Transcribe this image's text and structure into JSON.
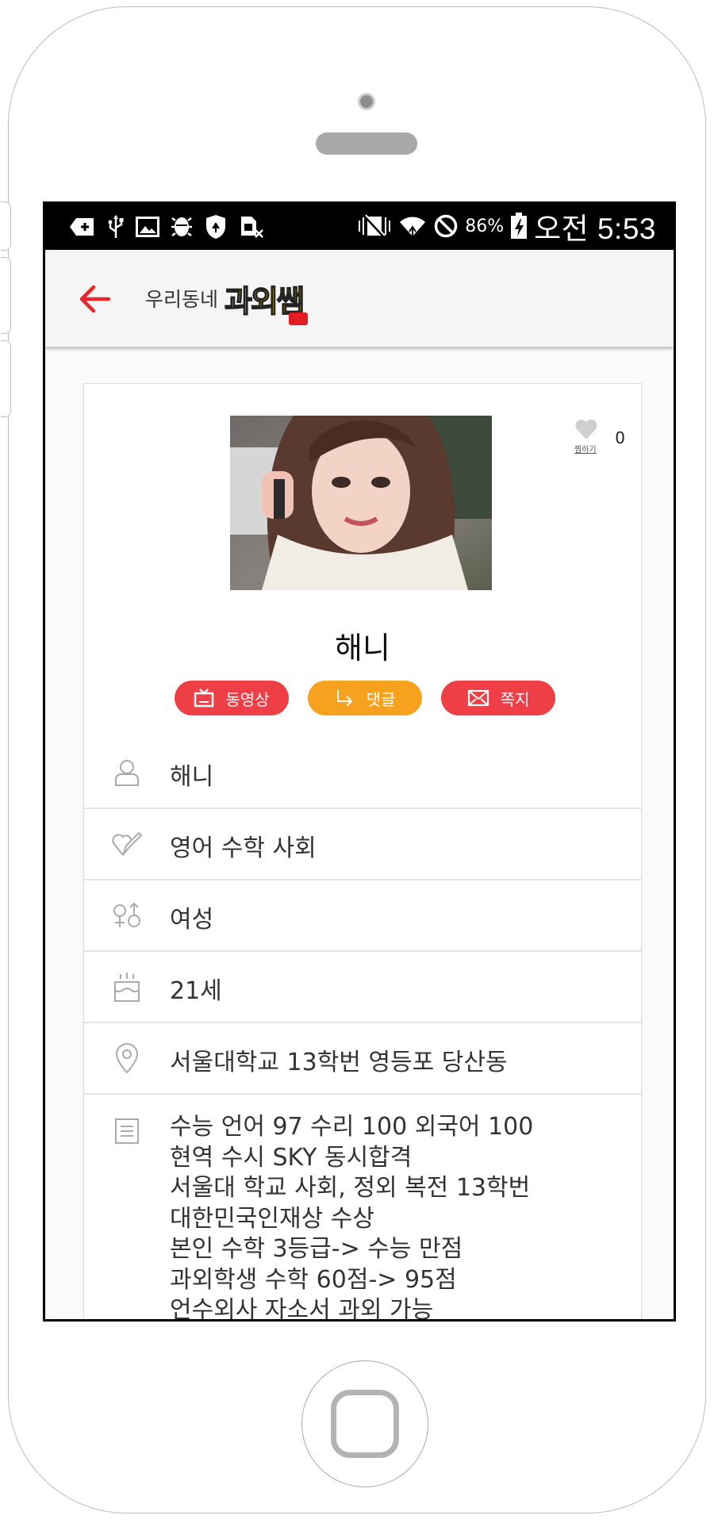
{
  "status_bar": {
    "battery_percent": "86%",
    "time": "오전 5:53",
    "icons": [
      "add-notification-icon",
      "usb-icon",
      "image-icon",
      "android-debug-icon",
      "shield-icon",
      "sim-off-icon",
      "vibrate-icon",
      "wifi-icon",
      "block-icon",
      "battery-charging-icon"
    ]
  },
  "app_bar": {
    "back_icon": "arrow-left-icon",
    "brand_small": "우리동네",
    "brand_big": "과외쌤"
  },
  "profile": {
    "name": "해니",
    "like_label": "찜하기",
    "like_count": "0",
    "buttons": [
      {
        "label": "동영상",
        "icon": "tv-icon",
        "color": "#ee3e46"
      },
      {
        "label": "댓글",
        "icon": "reply-arrow-icon",
        "color": "#f6a21e"
      },
      {
        "label": "쪽지",
        "icon": "mail-icon",
        "color": "#ee3e46"
      }
    ],
    "info_rows": [
      {
        "icon": "user-icon",
        "text": "해니"
      },
      {
        "icon": "subject-pencil-icon",
        "text": "영어 수학 사회"
      },
      {
        "icon": "gender-icon",
        "text": "여성"
      },
      {
        "icon": "cake-icon",
        "text": "21세"
      },
      {
        "icon": "location-pin-icon",
        "text": "서울대학교 13학번 영등포 당산동"
      }
    ],
    "description_icon": "document-icon",
    "description_lines": [
      "수능 언어 97 수리 100 외국어 100",
      "현역 수시 SKY 동시합격",
      "서울대 학교 사회, 정외 복전 13학번",
      "대한민국인재상 수상",
      "본인 수학 3등급-> 수능 만점",
      "과외학생 수학 60점-> 95점",
      "언수외사 자소서 과외 가능"
    ]
  },
  "colors": {
    "accent_red": "#ee3e46",
    "accent_orange": "#f6a21e",
    "back_arrow": "#e8262c"
  }
}
